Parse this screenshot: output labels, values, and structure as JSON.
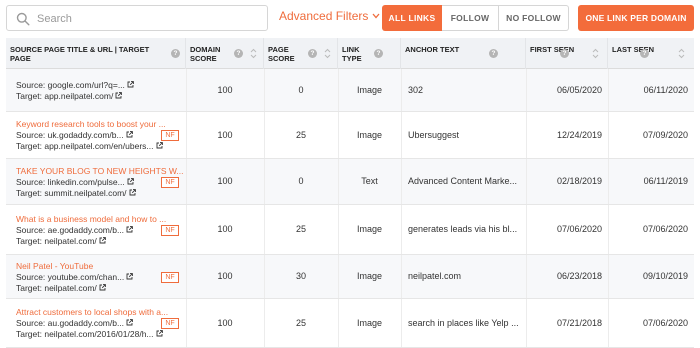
{
  "toolbar": {
    "search_placeholder": "Search",
    "advanced_filters": "Advanced Filters",
    "all_links": "ALL LINKS",
    "follow": "FOLLOW",
    "no_follow": "NO FOLLOW",
    "one_link_per_domain": "ONE LINK PER DOMAIN",
    "accent_color": "#f36c3b"
  },
  "table": {
    "headers": {
      "source": "SOURCE PAGE TITLE & URL | TARGET PAGE",
      "domain_score": "DOMAIN SCORE",
      "page_score": "PAGE SCORE",
      "link_type": "LINK TYPE",
      "anchor_text": "ANCHOR TEXT",
      "first_seen": "FIRST SEEN",
      "last_seen": "LAST SEEN"
    },
    "rows": [
      {
        "title": "",
        "source": "Source: google.com/url?q=...",
        "target": "Target: app.neilpatel.com/",
        "nf": "",
        "domain_score": "100",
        "page_score": "0",
        "link_type": "Image",
        "anchor": "302",
        "first_seen": "06/05/2020",
        "last_seen": "06/11/2020"
      },
      {
        "title": "Keyword research tools to boost your ...",
        "source": "Source: uk.godaddy.com/b...",
        "target": "Target: app.neilpatel.com/en/ubers...",
        "nf": "NF",
        "domain_score": "100",
        "page_score": "25",
        "link_type": "Image",
        "anchor": "Ubersuggest",
        "first_seen": "12/24/2019",
        "last_seen": "07/09/2020"
      },
      {
        "title": "TAKE YOUR BLOG TO NEW HEIGHTS W...",
        "source": "Source: linkedin.com/pulse...",
        "target": "Target: summit.neilpatel.com/",
        "nf": "NF",
        "domain_score": "100",
        "page_score": "0",
        "link_type": "Text",
        "anchor": "Advanced Content Marke...",
        "first_seen": "02/18/2019",
        "last_seen": "06/11/2019"
      },
      {
        "title": "What is a business model and how to ...",
        "source": "Source: ae.godaddy.com/b...",
        "target": "Target: neilpatel.com/",
        "nf": "NF",
        "domain_score": "100",
        "page_score": "25",
        "link_type": "Image",
        "anchor": "generates leads via his bl...",
        "first_seen": "07/06/2020",
        "last_seen": "07/06/2020"
      },
      {
        "title": "Neil Patel - YouTube",
        "source": "Source: youtube.com/chan...",
        "target": "Target: neilpatel.com/",
        "nf": "NF",
        "domain_score": "100",
        "page_score": "30",
        "link_type": "Image",
        "anchor": "neilpatel.com",
        "first_seen": "06/23/2018",
        "last_seen": "09/10/2019"
      },
      {
        "title": "Attract customers to local shops with a...",
        "source": "Source: au.godaddy.com/b...",
        "target": "Target: neilpatel.com/2016/01/28/h...",
        "nf": "NF",
        "domain_score": "100",
        "page_score": "25",
        "link_type": "Image",
        "anchor": "search in places like Yelp ...",
        "first_seen": "07/21/2018",
        "last_seen": "07/06/2020"
      }
    ]
  }
}
